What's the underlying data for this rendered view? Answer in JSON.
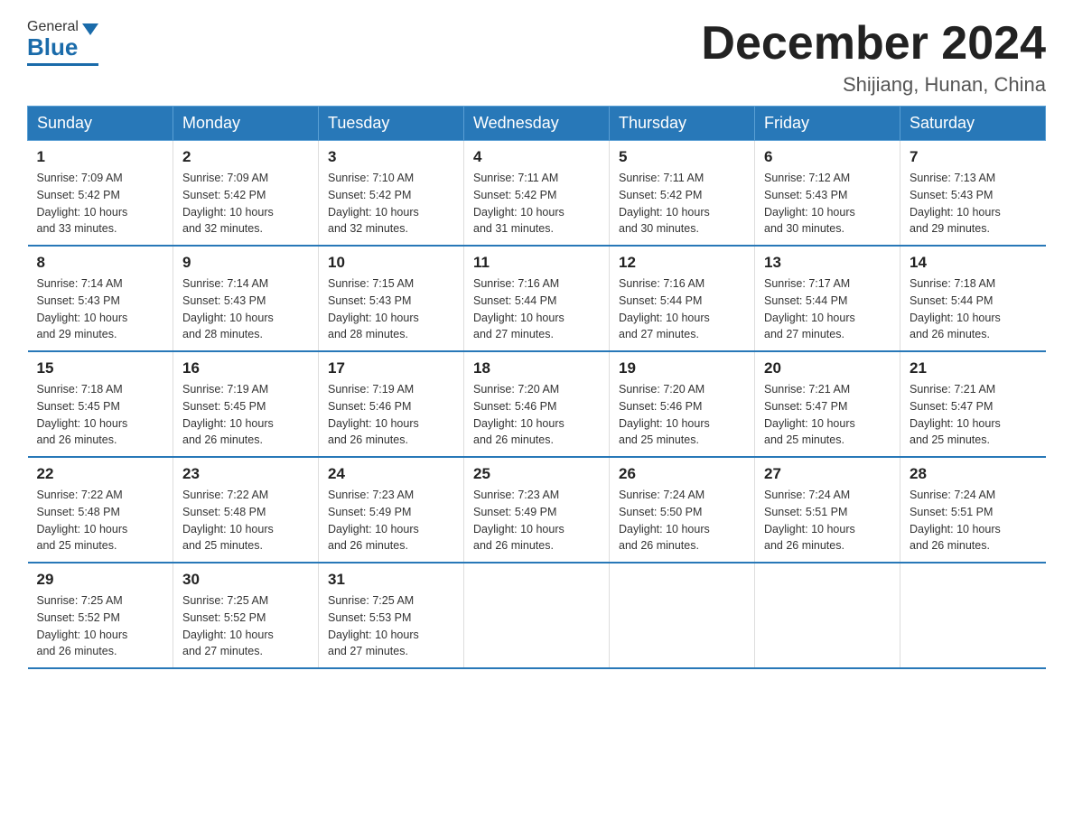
{
  "logo": {
    "general": "General",
    "blue": "Blue"
  },
  "header": {
    "title": "December 2024",
    "subtitle": "Shijiang, Hunan, China"
  },
  "days_of_week": [
    "Sunday",
    "Monday",
    "Tuesday",
    "Wednesday",
    "Thursday",
    "Friday",
    "Saturday"
  ],
  "weeks": [
    [
      {
        "day": "1",
        "sunrise": "7:09 AM",
        "sunset": "5:42 PM",
        "daylight": "10 hours and 33 minutes."
      },
      {
        "day": "2",
        "sunrise": "7:09 AM",
        "sunset": "5:42 PM",
        "daylight": "10 hours and 32 minutes."
      },
      {
        "day": "3",
        "sunrise": "7:10 AM",
        "sunset": "5:42 PM",
        "daylight": "10 hours and 32 minutes."
      },
      {
        "day": "4",
        "sunrise": "7:11 AM",
        "sunset": "5:42 PM",
        "daylight": "10 hours and 31 minutes."
      },
      {
        "day": "5",
        "sunrise": "7:11 AM",
        "sunset": "5:42 PM",
        "daylight": "10 hours and 30 minutes."
      },
      {
        "day": "6",
        "sunrise": "7:12 AM",
        "sunset": "5:43 PM",
        "daylight": "10 hours and 30 minutes."
      },
      {
        "day": "7",
        "sunrise": "7:13 AM",
        "sunset": "5:43 PM",
        "daylight": "10 hours and 29 minutes."
      }
    ],
    [
      {
        "day": "8",
        "sunrise": "7:14 AM",
        "sunset": "5:43 PM",
        "daylight": "10 hours and 29 minutes."
      },
      {
        "day": "9",
        "sunrise": "7:14 AM",
        "sunset": "5:43 PM",
        "daylight": "10 hours and 28 minutes."
      },
      {
        "day": "10",
        "sunrise": "7:15 AM",
        "sunset": "5:43 PM",
        "daylight": "10 hours and 28 minutes."
      },
      {
        "day": "11",
        "sunrise": "7:16 AM",
        "sunset": "5:44 PM",
        "daylight": "10 hours and 27 minutes."
      },
      {
        "day": "12",
        "sunrise": "7:16 AM",
        "sunset": "5:44 PM",
        "daylight": "10 hours and 27 minutes."
      },
      {
        "day": "13",
        "sunrise": "7:17 AM",
        "sunset": "5:44 PM",
        "daylight": "10 hours and 27 minutes."
      },
      {
        "day": "14",
        "sunrise": "7:18 AM",
        "sunset": "5:44 PM",
        "daylight": "10 hours and 26 minutes."
      }
    ],
    [
      {
        "day": "15",
        "sunrise": "7:18 AM",
        "sunset": "5:45 PM",
        "daylight": "10 hours and 26 minutes."
      },
      {
        "day": "16",
        "sunrise": "7:19 AM",
        "sunset": "5:45 PM",
        "daylight": "10 hours and 26 minutes."
      },
      {
        "day": "17",
        "sunrise": "7:19 AM",
        "sunset": "5:46 PM",
        "daylight": "10 hours and 26 minutes."
      },
      {
        "day": "18",
        "sunrise": "7:20 AM",
        "sunset": "5:46 PM",
        "daylight": "10 hours and 26 minutes."
      },
      {
        "day": "19",
        "sunrise": "7:20 AM",
        "sunset": "5:46 PM",
        "daylight": "10 hours and 25 minutes."
      },
      {
        "day": "20",
        "sunrise": "7:21 AM",
        "sunset": "5:47 PM",
        "daylight": "10 hours and 25 minutes."
      },
      {
        "day": "21",
        "sunrise": "7:21 AM",
        "sunset": "5:47 PM",
        "daylight": "10 hours and 25 minutes."
      }
    ],
    [
      {
        "day": "22",
        "sunrise": "7:22 AM",
        "sunset": "5:48 PM",
        "daylight": "10 hours and 25 minutes."
      },
      {
        "day": "23",
        "sunrise": "7:22 AM",
        "sunset": "5:48 PM",
        "daylight": "10 hours and 25 minutes."
      },
      {
        "day": "24",
        "sunrise": "7:23 AM",
        "sunset": "5:49 PM",
        "daylight": "10 hours and 26 minutes."
      },
      {
        "day": "25",
        "sunrise": "7:23 AM",
        "sunset": "5:49 PM",
        "daylight": "10 hours and 26 minutes."
      },
      {
        "day": "26",
        "sunrise": "7:24 AM",
        "sunset": "5:50 PM",
        "daylight": "10 hours and 26 minutes."
      },
      {
        "day": "27",
        "sunrise": "7:24 AM",
        "sunset": "5:51 PM",
        "daylight": "10 hours and 26 minutes."
      },
      {
        "day": "28",
        "sunrise": "7:24 AM",
        "sunset": "5:51 PM",
        "daylight": "10 hours and 26 minutes."
      }
    ],
    [
      {
        "day": "29",
        "sunrise": "7:25 AM",
        "sunset": "5:52 PM",
        "daylight": "10 hours and 26 minutes."
      },
      {
        "day": "30",
        "sunrise": "7:25 AM",
        "sunset": "5:52 PM",
        "daylight": "10 hours and 27 minutes."
      },
      {
        "day": "31",
        "sunrise": "7:25 AM",
        "sunset": "5:53 PM",
        "daylight": "10 hours and 27 minutes."
      },
      null,
      null,
      null,
      null
    ]
  ],
  "labels": {
    "sunrise": "Sunrise:",
    "sunset": "Sunset:",
    "daylight": "Daylight:"
  }
}
